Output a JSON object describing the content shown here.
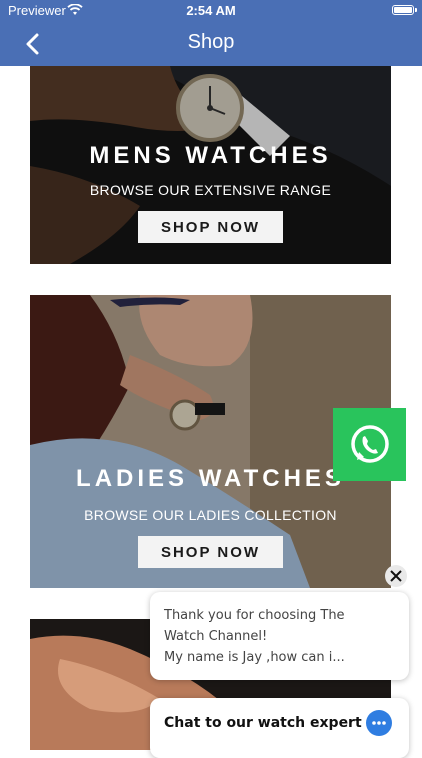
{
  "status_bar": {
    "carrier": "Previewer",
    "time": "2:54 AM"
  },
  "nav": {
    "title": "Shop"
  },
  "banners": [
    {
      "title": "MENS WATCHES",
      "subtitle": "BROWSE OUR EXTENSIVE RANGE",
      "button": "SHOP NOW"
    },
    {
      "title": "LADIES WATCHES",
      "subtitle": "BROWSE OUR LADIES COLLECTION",
      "button": "SHOP NOW"
    }
  ],
  "chat": {
    "message_line1": "Thank you for choosing The",
    "message_line2": "Watch Channel!",
    "message_line3": "My name is Jay ,how can i...",
    "cta": "Chat to our watch expert"
  },
  "colors": {
    "nav": "#4a6fb5",
    "whatsapp": "#29c45c",
    "chat_icon": "#2f7de1"
  }
}
